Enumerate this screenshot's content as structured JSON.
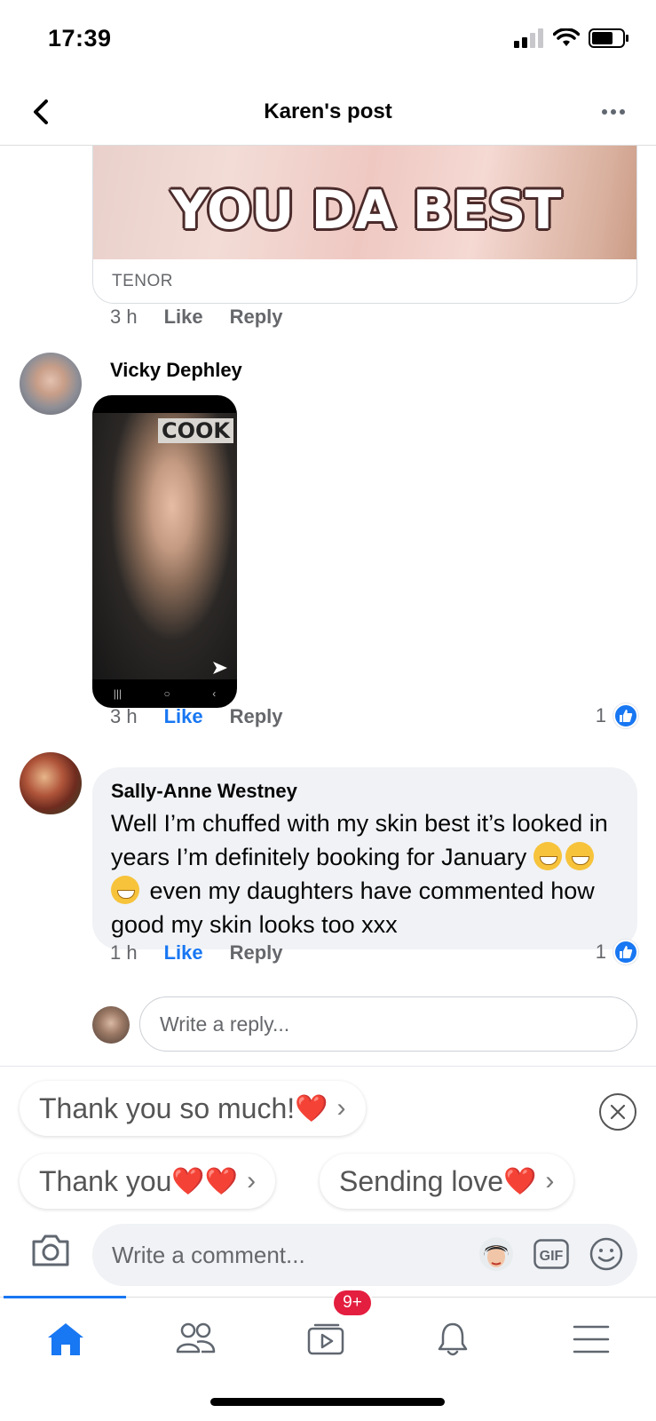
{
  "status_bar": {
    "time": "17:39"
  },
  "header": {
    "title": "Karen's post"
  },
  "gif_comment": {
    "caption": "YOU DA BEST",
    "source": "TENOR",
    "time": "3 h",
    "like_label": "Like",
    "reply_label": "Reply"
  },
  "comment_vicky": {
    "author": "Vicky Dephley",
    "time": "3 h",
    "like_label": "Like",
    "reply_label": "Reply",
    "like_count": "1",
    "photo_sign": "COOK"
  },
  "comment_sally": {
    "author": "Sally-Anne Westney",
    "text_before": "Well I’m chuffed with my skin best it’s looked in years I’m definitely booking for January ",
    "text_after": " even my daughters have commented how good my skin looks too xxx",
    "time": "1 h",
    "like_label": "Like",
    "reply_label": "Reply",
    "like_count": "1"
  },
  "reply_box": {
    "placeholder": "Write a reply..."
  },
  "suggestions": {
    "items": [
      {
        "label": "Thank you so much!",
        "hearts": "❤️"
      },
      {
        "label": "Thank you ",
        "hearts": "❤️❤️"
      },
      {
        "label": "Sending love ",
        "hearts": "❤️"
      }
    ]
  },
  "composer": {
    "placeholder": "Write a comment...",
    "gif_label": "GIF"
  },
  "tabbar": {
    "watch_badge": "9+"
  },
  "colors": {
    "accent": "#1877f2",
    "badge": "#e41e3f",
    "bubble": "#f0f2f5"
  }
}
